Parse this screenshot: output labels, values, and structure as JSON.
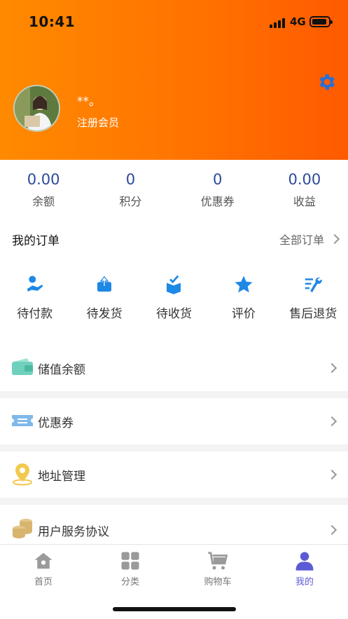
{
  "status_bar": {
    "time": "10:41",
    "network": "4G"
  },
  "profile": {
    "name": "**。",
    "level": "注册会员"
  },
  "stats": [
    {
      "value": "0.00",
      "label": "余额"
    },
    {
      "value": "0",
      "label": "积分"
    },
    {
      "value": "0",
      "label": "优惠券"
    },
    {
      "value": "0.00",
      "label": "收益"
    }
  ],
  "orders": {
    "title": "我的订单",
    "all_label": "全部订单",
    "items": [
      {
        "label": "待付款",
        "icon": "payment-hand-icon"
      },
      {
        "label": "待发货",
        "icon": "box-upload-icon"
      },
      {
        "label": "待收货",
        "icon": "box-check-icon"
      },
      {
        "label": "评价",
        "icon": "star-icon"
      },
      {
        "label": "售后退货",
        "icon": "wrench-list-icon"
      }
    ]
  },
  "menu": [
    {
      "label": "储值余额",
      "icon": "wallet-icon"
    },
    {
      "label": "优惠券",
      "icon": "ticket-icon"
    },
    {
      "label": "地址管理",
      "icon": "location-pin-icon"
    },
    {
      "label": "用户服务协议",
      "icon": "coins-icon"
    }
  ],
  "tabs": [
    {
      "label": "首页",
      "icon": "home-icon"
    },
    {
      "label": "分类",
      "icon": "category-grid-icon"
    },
    {
      "label": "购物车",
      "icon": "cart-icon"
    },
    {
      "label": "我的",
      "icon": "user-icon",
      "active": true
    }
  ],
  "colors": {
    "header_gradient_start": "#ff8a00",
    "header_gradient_end": "#ff5a00",
    "accent_blue": "#1e88e5",
    "stat_value": "#2d4a9a",
    "active_tab": "#5b5bd6"
  }
}
